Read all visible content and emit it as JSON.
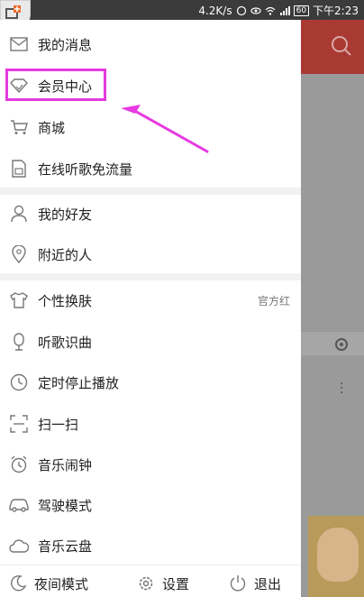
{
  "status_bar": {
    "speed": "4.2K/s",
    "battery": "60",
    "time": "下午2:23"
  },
  "drawer": {
    "group1": [
      {
        "label": "我的消息",
        "icon": "mail-icon"
      },
      {
        "label": "会员中心",
        "icon": "diamond-icon"
      },
      {
        "label": "商城",
        "icon": "cart-icon"
      },
      {
        "label": "在线听歌免流量",
        "icon": "sim-card-icon"
      }
    ],
    "group2": [
      {
        "label": "我的好友",
        "icon": "person-icon"
      },
      {
        "label": "附近的人",
        "icon": "location-pin-icon"
      }
    ],
    "group3": [
      {
        "label": "个性换肤",
        "icon": "tshirt-icon",
        "value": "官方红"
      },
      {
        "label": "听歌识曲",
        "icon": "microphone-icon"
      },
      {
        "label": "定时停止播放",
        "icon": "clock-icon"
      },
      {
        "label": "扫一扫",
        "icon": "scan-icon"
      },
      {
        "label": "音乐闹钟",
        "icon": "alarm-icon"
      },
      {
        "label": "驾驶模式",
        "icon": "car-icon"
      },
      {
        "label": "音乐云盘",
        "icon": "cloud-icon"
      }
    ],
    "bottom": {
      "night_mode": "夜间模式",
      "settings": "设置",
      "exit": "退出"
    }
  },
  "colors": {
    "header_red": "#a93a33",
    "highlight": "#e63ae0"
  }
}
